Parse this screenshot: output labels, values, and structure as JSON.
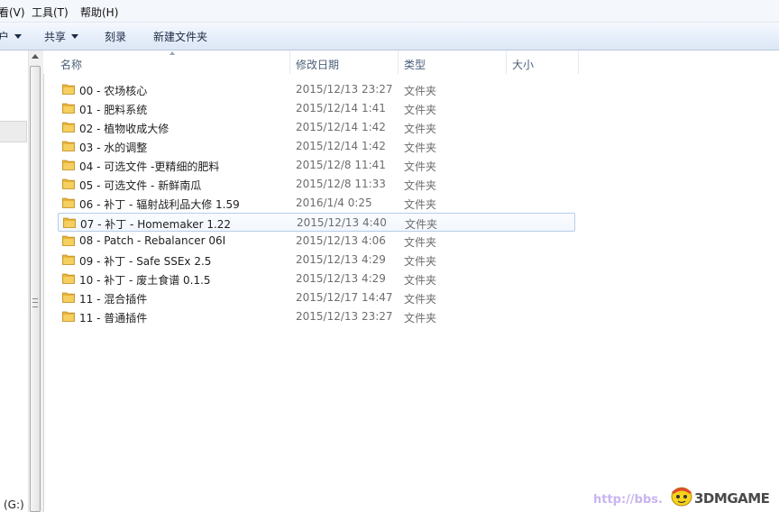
{
  "menubar": {
    "view": "看(V)",
    "tools": "工具(T)",
    "help": "帮助(H)"
  },
  "toolbar": {
    "organize": "户",
    "share": "共享",
    "burn": "刻录",
    "new_folder": "新建文件夹"
  },
  "columns": {
    "name": "名称",
    "date": "修改日期",
    "type": "类型",
    "size": "大小"
  },
  "files": [
    {
      "name": "00 - 农场核心",
      "date": "2015/12/13 23:27",
      "type": "文件夹"
    },
    {
      "name": "01 - 肥料系统",
      "date": "2015/12/14 1:41",
      "type": "文件夹"
    },
    {
      "name": "02 - 植物收成大修",
      "date": "2015/12/14 1:42",
      "type": "文件夹"
    },
    {
      "name": "03 - 水的调整",
      "date": "2015/12/14 1:42",
      "type": "文件夹"
    },
    {
      "name": "04 - 可选文件 -更精细的肥料",
      "date": "2015/12/8 11:41",
      "type": "文件夹"
    },
    {
      "name": "05 - 可选文件 - 新鲜南瓜",
      "date": "2015/12/8 11:33",
      "type": "文件夹"
    },
    {
      "name": "06 - 补丁 - 辐射战利品大修 1.59",
      "date": "2016/1/4 0:25",
      "type": "文件夹"
    },
    {
      "name": "07 - 补丁 - Homemaker 1.22",
      "date": "2015/12/13 4:40",
      "type": "文件夹"
    },
    {
      "name": "08 - Patch - Rebalancer 06I",
      "date": "2015/12/13 4:06",
      "type": "文件夹"
    },
    {
      "name": "09 - 补丁 - Safe SSEx 2.5",
      "date": "2015/12/13 4:29",
      "type": "文件夹"
    },
    {
      "name": "10 - 补丁 - 废土食谱 0.1.5",
      "date": "2015/12/13 4:29",
      "type": "文件夹"
    },
    {
      "name": "11 - 混合插件",
      "date": "2015/12/17 14:47",
      "type": "文件夹"
    },
    {
      "name": "11 - 普通插件",
      "date": "2015/12/13 23:27",
      "type": "文件夹"
    }
  ],
  "nav": {
    "drive": "(G:)"
  },
  "watermark": {
    "url": "http://bbs.",
    "brand": "3DMGAME"
  },
  "colors": {
    "toolbar_top": "#f5f9fe",
    "toolbar_bottom": "#dce7f5",
    "folder": "#f0c14d",
    "hover_border": "#b6cce8",
    "header_text": "#4c607a"
  }
}
